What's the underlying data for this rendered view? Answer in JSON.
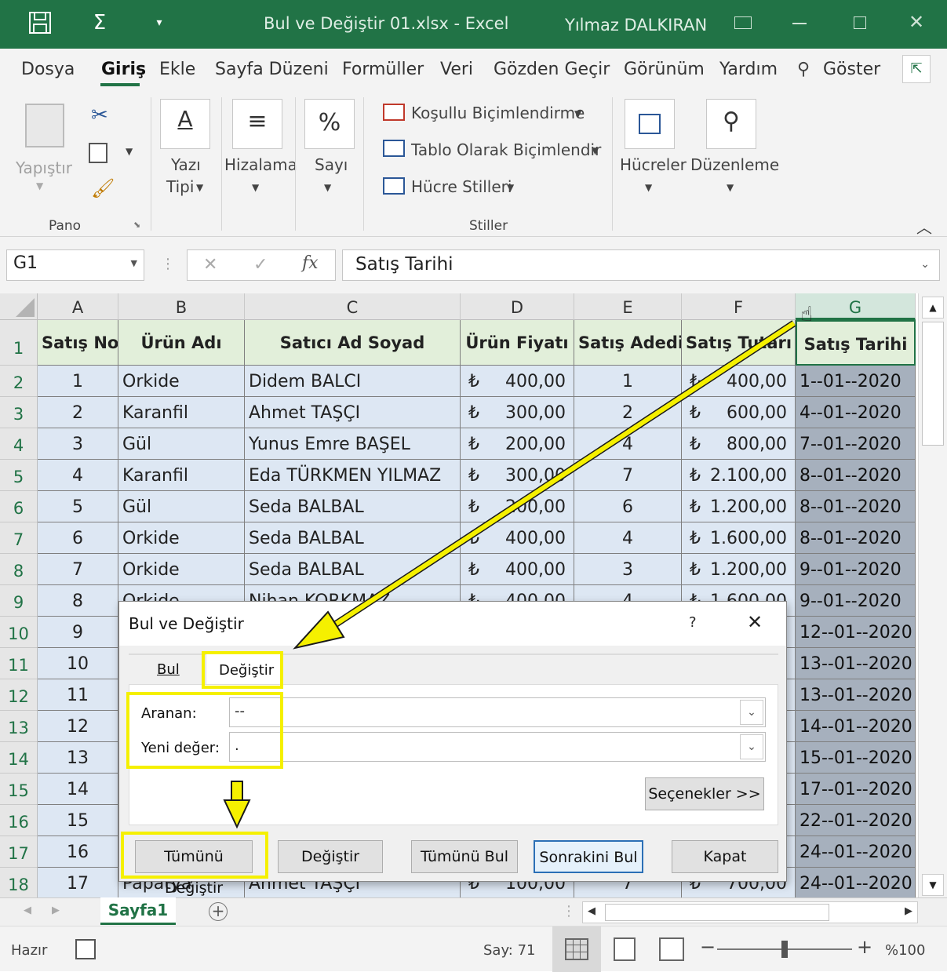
{
  "window": {
    "title": "Bul ve Değiştir 01.xlsx  -  Excel",
    "user": "Yılmaz DALKIRAN"
  },
  "tabs": [
    "Dosya",
    "Giriş",
    "Ekle",
    "Sayfa Düzeni",
    "Formüller",
    "Veri",
    "Gözden Geçir",
    "Görünüm",
    "Yardım",
    "Göster"
  ],
  "ribbon": {
    "paste": "Yapıştır",
    "clipboard_group": "Pano",
    "font_line1": "Yazı",
    "font_line2": "Tipi",
    "align": "Hizalama",
    "number": "Sayı",
    "cond_format": "Koşullu Biçimlendirme",
    "table_format": "Tablo Olarak Biçimlendir",
    "cell_styles": "Hücre Stilleri",
    "styles_group": "Stiller",
    "cells": "Hücreler",
    "editing": "Düzenleme"
  },
  "formula_bar": {
    "name_box": "G1",
    "fx": "fx",
    "content": "Satış Tarihi"
  },
  "columns": [
    "A",
    "B",
    "C",
    "D",
    "E",
    "F",
    "G"
  ],
  "headers": [
    "Satış No",
    "Ürün Adı",
    "Satıcı Ad Soyad",
    "Ürün Fiyatı",
    "Satış Adedi",
    "Satış Tutarı",
    "Satış Tarihi"
  ],
  "rows": [
    [
      "1",
      "Orkide",
      "Didem BALCI",
      "400,00",
      "1",
      "400,00",
      "1--01--2020"
    ],
    [
      "2",
      "Karanfil",
      "Ahmet TAŞÇI",
      "300,00",
      "2",
      "600,00",
      "4--01--2020"
    ],
    [
      "3",
      "Gül",
      "Yunus Emre BAŞEL",
      "200,00",
      "4",
      "800,00",
      "7--01--2020"
    ],
    [
      "4",
      "Karanfil",
      "Eda TÜRKMEN YILMAZ",
      "300,00",
      "7",
      "2.100,00",
      "8--01--2020"
    ],
    [
      "5",
      "Gül",
      "Seda BALBAL",
      "200,00",
      "6",
      "1.200,00",
      "8--01--2020"
    ],
    [
      "6",
      "Orkide",
      "Seda BALBAL",
      "400,00",
      "4",
      "1.600,00",
      "8--01--2020"
    ],
    [
      "7",
      "Orkide",
      "Seda BALBAL",
      "400,00",
      "3",
      "1.200,00",
      "9--01--2020"
    ],
    [
      "8",
      "Orkide",
      "Nihan KORKMAZ",
      "400,00",
      "4",
      "1.600,00",
      "9--01--2020"
    ],
    [
      "9",
      "",
      "",
      "",
      "",
      "",
      "12--01--2020"
    ],
    [
      "10",
      "",
      "",
      "",
      "",
      "",
      "13--01--2020"
    ],
    [
      "11",
      "",
      "",
      "",
      "",
      "",
      "13--01--2020"
    ],
    [
      "12",
      "",
      "",
      "",
      "",
      "",
      "14--01--2020"
    ],
    [
      "13",
      "",
      "",
      "",
      "",
      "",
      "15--01--2020"
    ],
    [
      "14",
      "",
      "",
      "",
      "",
      "",
      "17--01--2020"
    ],
    [
      "15",
      "",
      "",
      "",
      "",
      "",
      "22--01--2020"
    ],
    [
      "16",
      "",
      "",
      "",
      "",
      "",
      "24--01--2020"
    ],
    [
      "17",
      "Papatya",
      "Ahmet TAŞÇI",
      "100,00",
      "7",
      "700,00",
      "24--01--2020"
    ]
  ],
  "currency": "₺",
  "sheet": {
    "name": "Sayfa1"
  },
  "status": {
    "ready": "Hazır",
    "count": "Say: 71",
    "zoom": "%100"
  },
  "dialog": {
    "title": "Bul ve Değiştir",
    "help": "?",
    "tab_find": "Bul",
    "tab_replace": "Değiştir",
    "find_label": "Aranan:",
    "find_value": "--",
    "replace_label": "Yeni değer:",
    "replace_value": ".",
    "options": "Seçenekler >>",
    "btn_replace_all": "Tümünü Değiştir",
    "btn_replace": "Değiştir",
    "btn_find_all": "Tümünü Bul",
    "btn_find_next": "Sonrakini Bul",
    "btn_close": "Kapat"
  },
  "colors": {
    "excel_green": "#217346",
    "highlight": "#f5f000",
    "header_fill": "#e2efda",
    "data_fill": "#dde7f3",
    "selected_fill": "#a6b0bd"
  }
}
